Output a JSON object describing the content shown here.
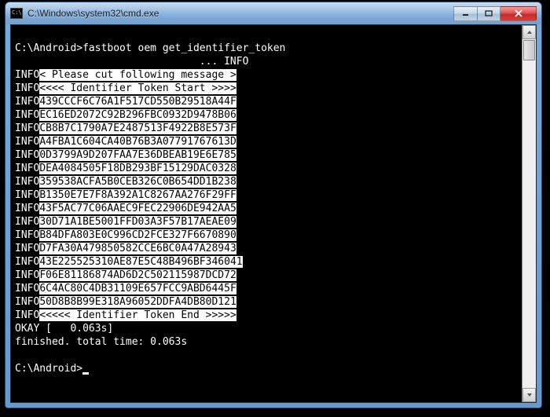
{
  "window": {
    "title": "C:\\Windows\\system32\\cmd.exe"
  },
  "prompt1": "C:\\Android>",
  "command": "fastboot oem get_identifier_token",
  "partial_info": "                              ... INFO",
  "cut_msg_prefix": "INFO",
  "cut_msg_body": "< Please cut following message >",
  "token_start_prefix": "INFO",
  "token_start_body": "<<<< Identifier Token Start >>>>",
  "token_lines": [
    {
      "p": "INFO",
      "v": "439CCCF6C76A1F517CD550B29518A44F"
    },
    {
      "p": "INFO",
      "v": "EC16ED2072C92B296FBC0932D9478B06"
    },
    {
      "p": "INFO",
      "v": "CB8B7C1790A7E2487513F4922B8E573F"
    },
    {
      "p": "INFO",
      "v": "A4FBA1C604CA40B76B3A07791767613D"
    },
    {
      "p": "INFO",
      "v": "0D3799A9D207FAA7E36DBEAB19E6E785"
    },
    {
      "p": "INFO",
      "v": "DEA4084505F18DB293BF15129DAC0328"
    },
    {
      "p": "INFO",
      "v": "359538ACFA5B0CEB326C0B654DD1B238"
    },
    {
      "p": "INFO",
      "v": "B1350E7E7F8A392A1C8267AA276F29FF"
    },
    {
      "p": "INFO",
      "v": "43F5AC77C06AAEC9FEC22906DE942AA5"
    },
    {
      "p": "INFO",
      "v": "30D71A1BE5001FFD03A3F57B17AEAE09"
    },
    {
      "p": "INFO",
      "v": "B84DFA803E0C996CD2FCE327F6670890"
    },
    {
      "p": "INFO",
      "v": "D7FA30A479850582CCE6BC0A47A28943"
    },
    {
      "p": "INFO",
      "v": "43E225525310AE87E5C48B496BF346041"
    },
    {
      "p": "INFO",
      "v": "F06E81186874AD6D2C502115987DCD72"
    },
    {
      "p": "INFO",
      "v": "6C4AC80C4DB31109E657FCC9ABD6445F"
    },
    {
      "p": "INFO",
      "v": "50D8B8B99E318A96052DDFA4DB80D121"
    }
  ],
  "token_end_prefix": "INFO",
  "token_end_body": "<<<<< Identifier Token End >>>>>",
  "okay_line": "OKAY [   0.063s]",
  "finished_line": "finished. total time: 0.063s",
  "prompt2": "C:\\Android>"
}
